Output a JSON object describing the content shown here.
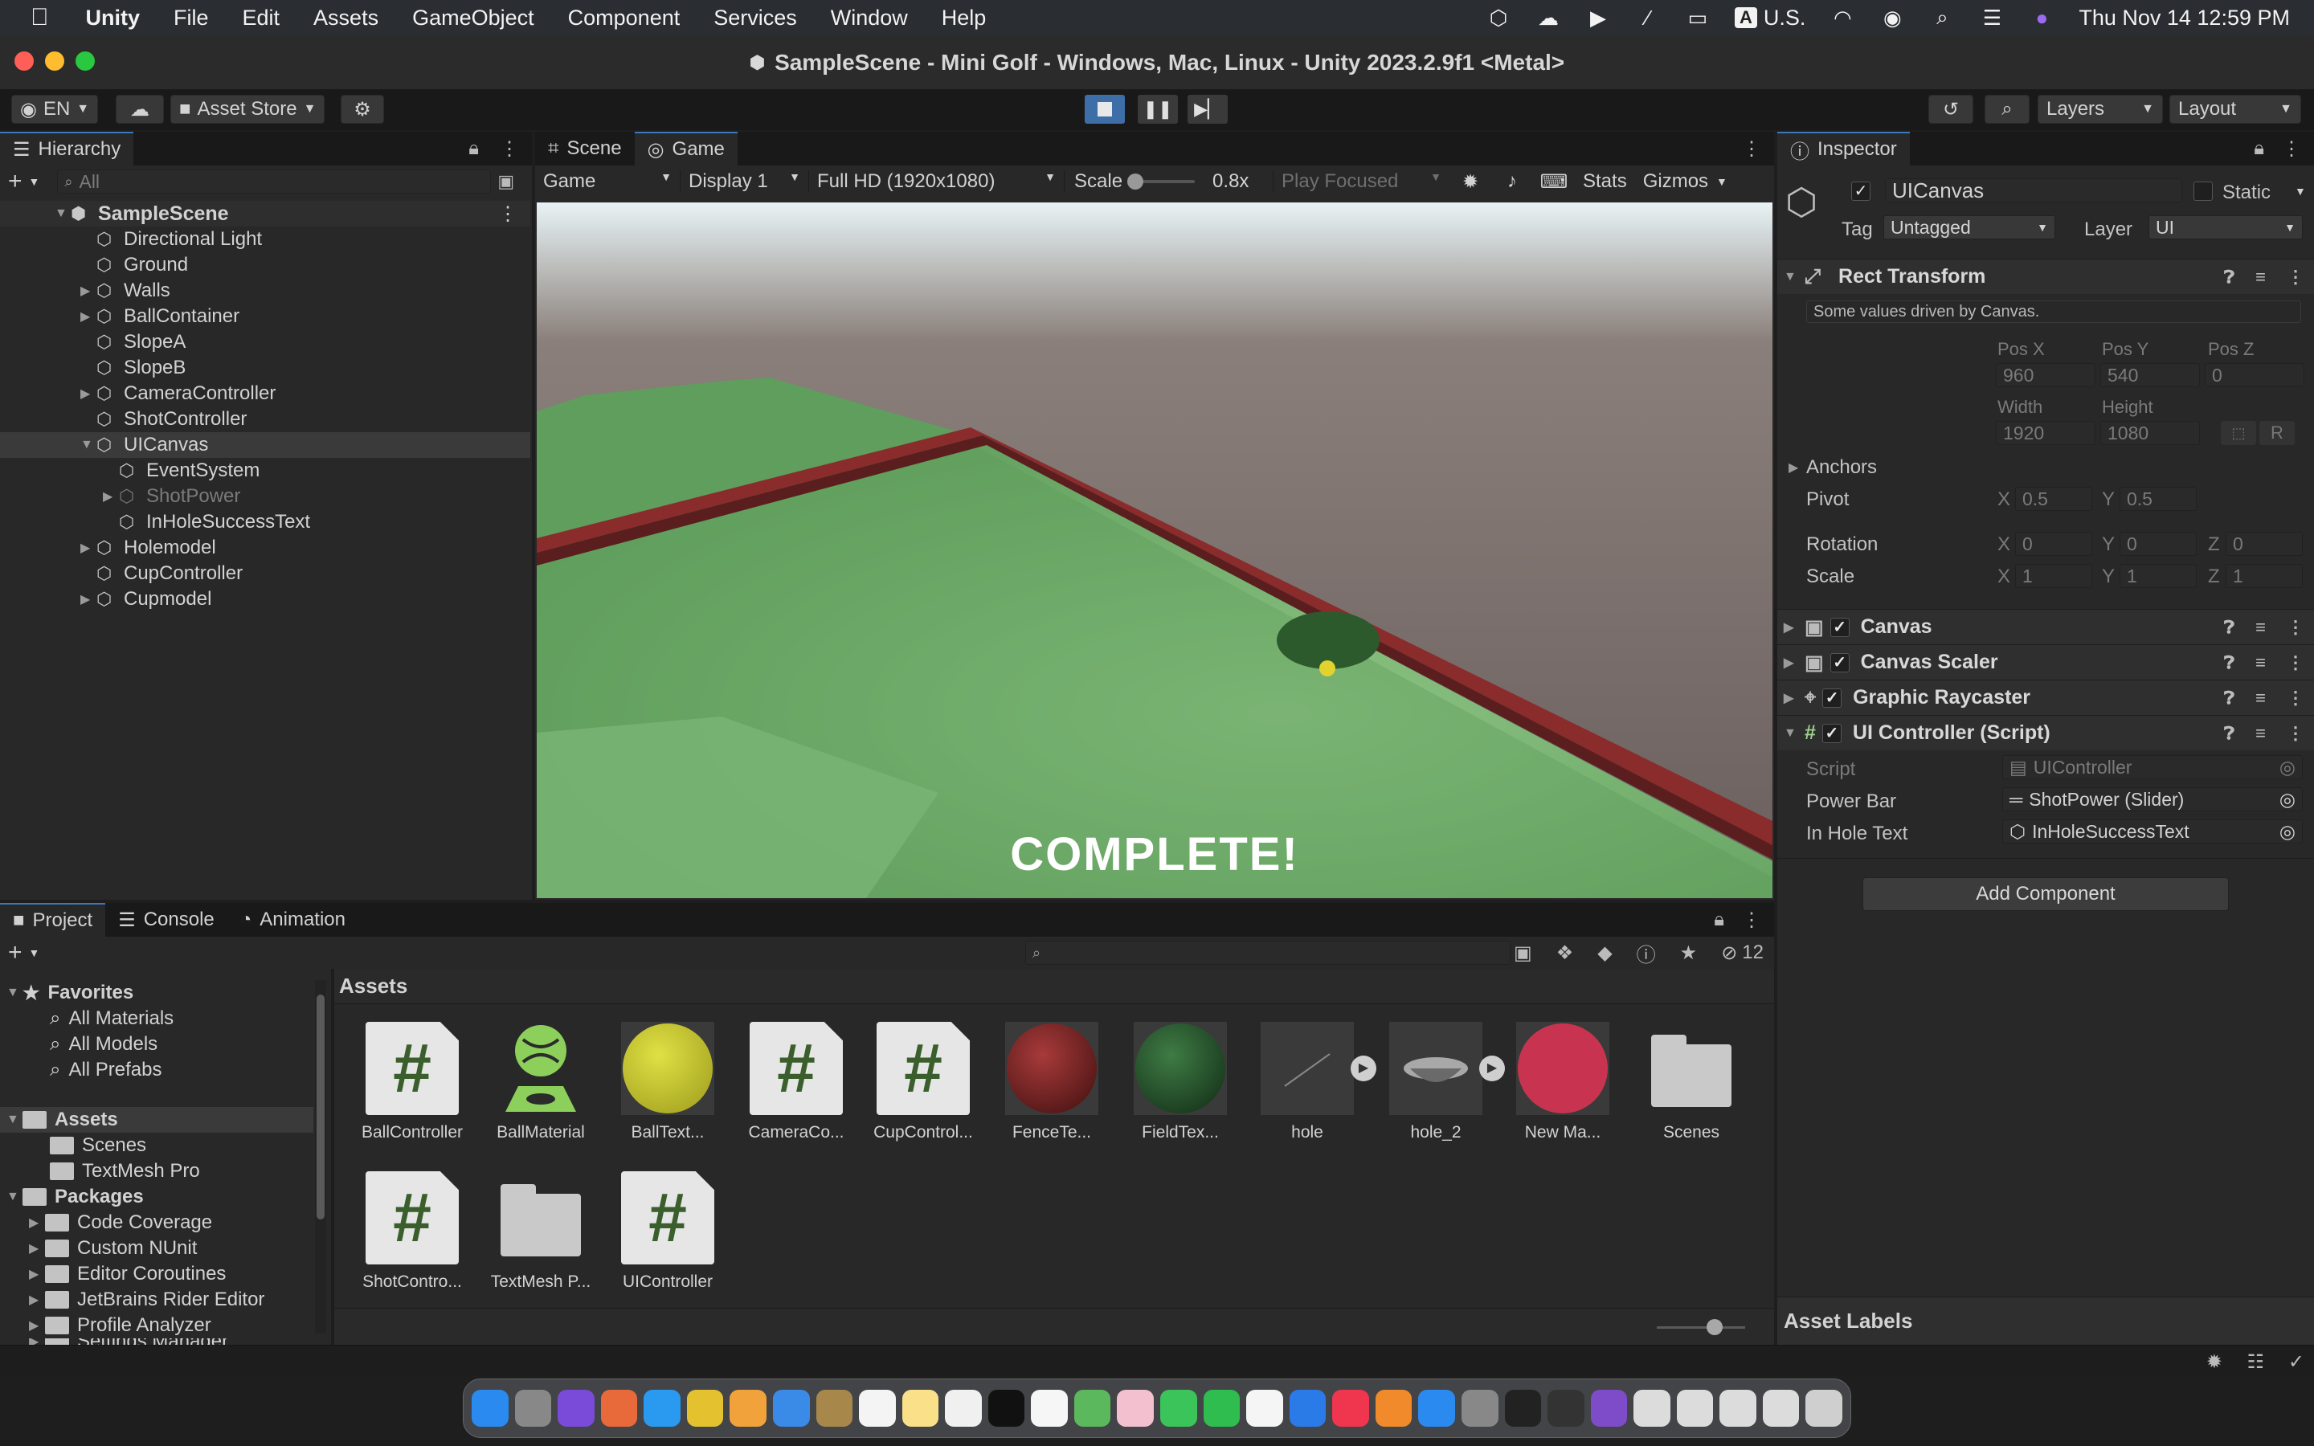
{
  "menubar": {
    "app": "Unity",
    "items": [
      "File",
      "Edit",
      "Assets",
      "GameObject",
      "Component",
      "Services",
      "Window",
      "Help"
    ],
    "input_source": "U.S.",
    "input_badge": "A",
    "clock": "Thu Nov 14  12:59 PM"
  },
  "window": {
    "title": "SampleScene - Mini Golf - Windows, Mac, Linux - Unity 2023.2.9f1 <Metal>"
  },
  "toolbar": {
    "lang": "EN",
    "asset_store": "Asset Store",
    "layers": "Layers",
    "layout": "Layout"
  },
  "hierarchy": {
    "tab": "Hierarchy",
    "search_placeholder": "All",
    "scene": "SampleScene",
    "items": [
      "Directional Light",
      "Ground",
      "Walls",
      "BallContainer",
      "SlopeA",
      "SlopeB",
      "CameraController",
      "ShotController",
      "UICanvas",
      "EventSystem",
      "ShotPower",
      "InHoleSuccessText",
      "Holemodel",
      "CupController",
      "Cupmodel"
    ]
  },
  "gameview": {
    "tabs": [
      "Scene",
      "Game"
    ],
    "mode": "Game",
    "display": "Display 1",
    "resolution": "Full HD (1920x1080)",
    "scale_label": "Scale",
    "scale_value": "0.8x",
    "play_focused": "Play Focused",
    "stats": "Stats",
    "gizmos": "Gizmos",
    "overlay_text": "COMPLETE!"
  },
  "inspector": {
    "tab": "Inspector",
    "object_name": "UICanvas",
    "static_label": "Static",
    "tag_label": "Tag",
    "tag_value": "Untagged",
    "layer_label": "Layer",
    "layer_value": "UI",
    "rect_transform": {
      "title": "Rect Transform",
      "note": "Some values driven by Canvas.",
      "pos_x_label": "Pos X",
      "pos_y_label": "Pos Y",
      "pos_z_label": "Pos Z",
      "pos_x": "960",
      "pos_y": "540",
      "pos_z": "0",
      "width_label": "Width",
      "height_label": "Height",
      "width": "1920",
      "height": "1080",
      "r_button": "R",
      "anchors": "Anchors",
      "pivot": "Pivot",
      "pivot_x": "0.5",
      "pivot_y": "0.5",
      "rotation": "Rotation",
      "rot_x": "0",
      "rot_y": "0",
      "rot_z": "0",
      "scale": "Scale",
      "scale_x": "1",
      "scale_y": "1",
      "scale_z": "1",
      "x": "X",
      "y": "Y",
      "z": "Z"
    },
    "components": [
      "Canvas",
      "Canvas Scaler",
      "Graphic Raycaster",
      "UI Controller (Script)"
    ],
    "script_label": "Script",
    "script_value": "UIController",
    "power_bar_label": "Power Bar",
    "power_bar_value": "ShotPower (Slider)",
    "in_hole_label": "In Hole Text",
    "in_hole_value": "InHoleSuccessText",
    "add_component": "Add Component",
    "asset_labels": "Asset Labels"
  },
  "project": {
    "tabs": [
      "Project",
      "Console",
      "Animation"
    ],
    "hidden_count": "12",
    "favorites": "Favorites",
    "favorite_items": [
      "All Materials",
      "All Models",
      "All Prefabs"
    ],
    "assets_root": "Assets",
    "asset_folders": [
      "Scenes",
      "TextMesh Pro"
    ],
    "packages": "Packages",
    "package_items": [
      "Code Coverage",
      "Custom NUnit",
      "Editor Coroutines",
      "JetBrains Rider Editor",
      "Profile Analyzer",
      "Settings Manager"
    ],
    "breadcrumb": "Assets",
    "assets": [
      "BallController",
      "BallMaterial",
      "BallText...",
      "CameraCo...",
      "CupControl...",
      "FenceTe...",
      "FieldTex...",
      "hole",
      "hole_2",
      "New Ma...",
      "Scenes",
      "ShotContro...",
      "TextMesh P...",
      "UIController"
    ]
  },
  "colors": {
    "accent": "#3a79bb",
    "field_green": "#5e9e5c",
    "fence_red": "#7a2424"
  }
}
